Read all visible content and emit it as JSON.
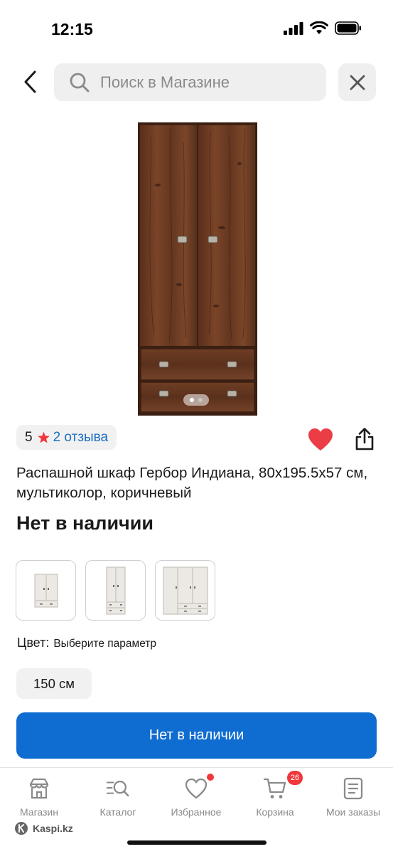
{
  "status_bar": {
    "time": "12:15"
  },
  "search": {
    "placeholder": "Поиск в Магазине"
  },
  "product": {
    "rating": "5",
    "reviews_label": "2 отзыва",
    "title": "Распашной шкаф Гербор Индиана, 80x195.5x57 см, мультиколор, коричневый",
    "availability": "Нет в наличии",
    "color_label": "Цвет:",
    "color_value": "Выберите параметр",
    "size": "150 см",
    "main_button_label": "Нет в наличии",
    "image_dots": {
      "count": 2,
      "active": 0
    },
    "favorited": true
  },
  "colors": {
    "accent": "#0f6cd0",
    "star": "#f0373c",
    "heart": "#ea3d45",
    "link": "#1a6fc0",
    "wood": "#6b3a22"
  },
  "variants": [
    {
      "icon": "wardrobe-2-door-icon"
    },
    {
      "icon": "wardrobe-tall-icon"
    },
    {
      "icon": "wardrobe-3-door-icon"
    }
  ],
  "bottom_nav": {
    "items": [
      {
        "label": "Магазин",
        "icon": "store-icon"
      },
      {
        "label": "Каталог",
        "icon": "catalog-search-icon"
      },
      {
        "label": "Избранное",
        "icon": "heart-icon"
      },
      {
        "label": "Корзина",
        "icon": "cart-icon",
        "badge": "26"
      },
      {
        "label": "Мои заказы",
        "icon": "orders-icon"
      }
    ]
  },
  "brand": "Kaspi.kz"
}
